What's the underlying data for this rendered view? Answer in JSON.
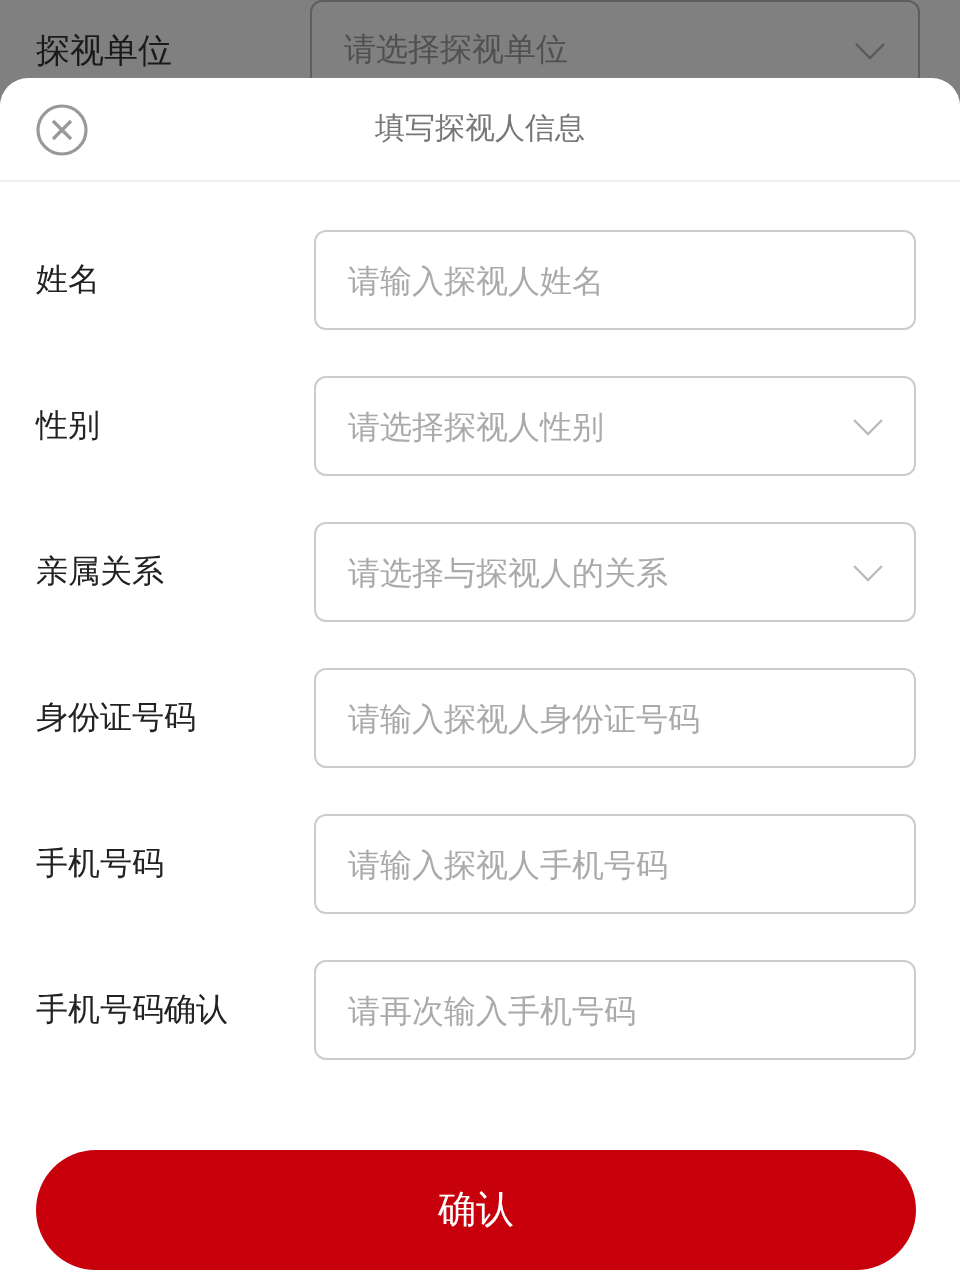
{
  "background_form": {
    "label": "探视单位",
    "placeholder": "请选择探视单位"
  },
  "dialog": {
    "title": "填写探视人信息"
  },
  "fields": [
    {
      "label": "姓名",
      "kind": "input",
      "placeholder": "请输入探视人姓名"
    },
    {
      "label": "性别",
      "kind": "select",
      "placeholder": "请选择探视人性别"
    },
    {
      "label": "亲属关系",
      "kind": "select",
      "placeholder": "请选择与探视人的关系"
    },
    {
      "label": "身份证号码",
      "kind": "input",
      "placeholder": "请输入探视人身份证号码"
    },
    {
      "label": "手机号码",
      "kind": "input",
      "placeholder": "请输入探视人手机号码"
    },
    {
      "label": "手机号码确认",
      "kind": "input",
      "placeholder": "请再次输入手机号码"
    }
  ],
  "confirm_button": "确认"
}
